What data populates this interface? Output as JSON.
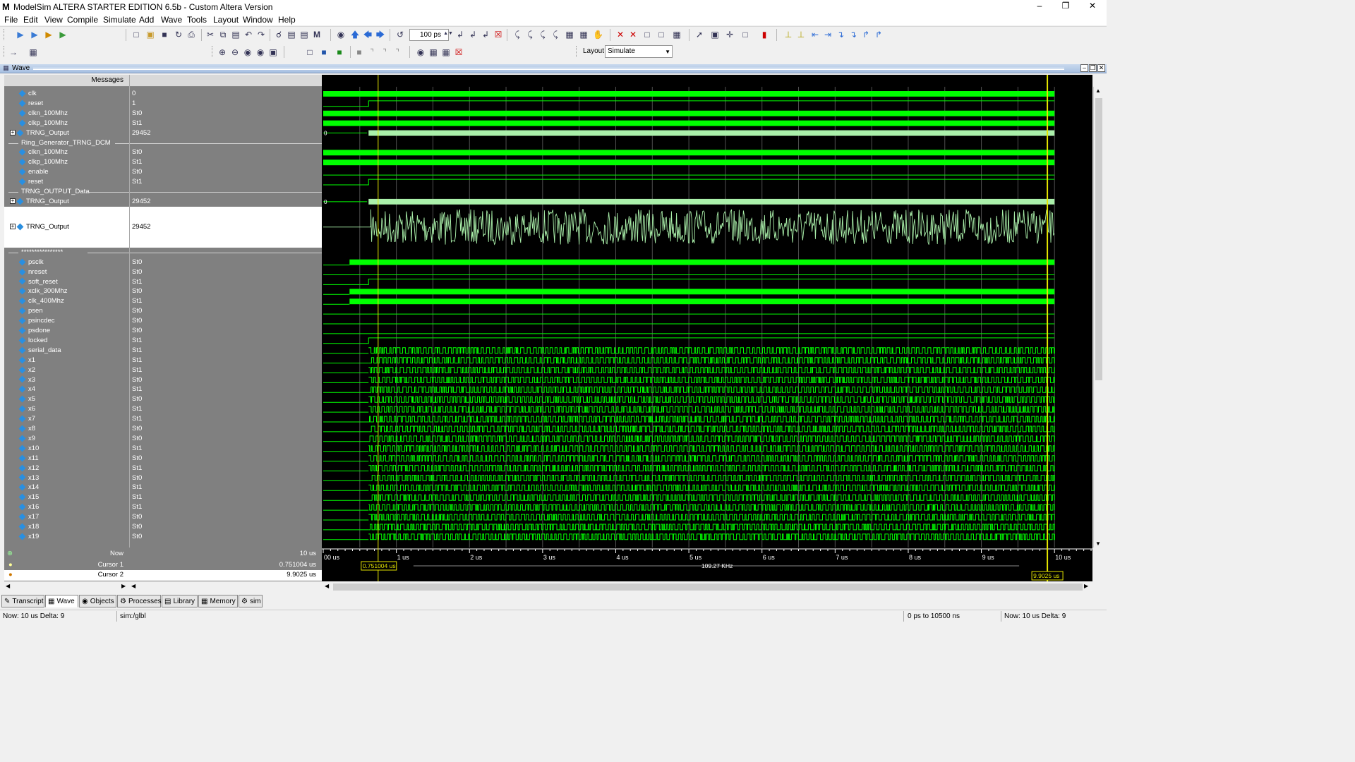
{
  "window": {
    "app_icon": "M",
    "title": "ModelSim ALTERA STARTER EDITION 6.5b - Custom Altera Version",
    "controls": [
      "minimize-icon",
      "restore-icon",
      "close-icon"
    ]
  },
  "menu": [
    "File",
    "Edit",
    "View",
    "Compile",
    "Simulate",
    "Add",
    "Wave",
    "Tools",
    "Layout",
    "Window",
    "Help"
  ],
  "toolbar": {
    "zoom_value": "100 ps",
    "layout_label": "Layout",
    "layout_value": "Simulate"
  },
  "wave_window": {
    "title": "Wave",
    "messages_header": "Messages"
  },
  "signals": [
    {
      "type": "signal",
      "name": "clk",
      "value": "0"
    },
    {
      "type": "signal",
      "name": "reset",
      "value": "1"
    },
    {
      "type": "signal",
      "name": "clkn_100Mhz",
      "value": "St0"
    },
    {
      "type": "signal",
      "name": "clkp_100Mhz",
      "value": "St1"
    },
    {
      "type": "bus",
      "name": "TRNG_Output",
      "value": "29452"
    },
    {
      "type": "divider",
      "name": "Ring_Generator_TRNG_DCM"
    },
    {
      "type": "signal",
      "name": "clkn_100Mhz",
      "value": "St0"
    },
    {
      "type": "signal",
      "name": "clkp_100Mhz",
      "value": "St1"
    },
    {
      "type": "signal",
      "name": "enable",
      "value": "St0"
    },
    {
      "type": "signal",
      "name": "reset",
      "value": "St1"
    },
    {
      "type": "divider",
      "name": "TRNG_OUTPUT_Data"
    },
    {
      "type": "bus",
      "name": "TRNG_Output",
      "value": "29452"
    },
    {
      "type": "analog",
      "name": "TRNG_Output",
      "value": "29452"
    },
    {
      "type": "divider",
      "name": "****************"
    },
    {
      "type": "signal",
      "name": "psclk",
      "value": "St0"
    },
    {
      "type": "signal",
      "name": "nreset",
      "value": "St0"
    },
    {
      "type": "signal",
      "name": "soft_reset",
      "value": "St1"
    },
    {
      "type": "signal",
      "name": "xclk_300Mhz",
      "value": "St0"
    },
    {
      "type": "signal",
      "name": "clk_400Mhz",
      "value": "St1"
    },
    {
      "type": "signal",
      "name": "psen",
      "value": "St0"
    },
    {
      "type": "signal",
      "name": "psincdec",
      "value": "St0"
    },
    {
      "type": "signal",
      "name": "psdone",
      "value": "St0"
    },
    {
      "type": "signal",
      "name": "locked",
      "value": "St1"
    },
    {
      "type": "signal",
      "name": "serial_data",
      "value": "St1"
    },
    {
      "type": "signal",
      "name": "x1",
      "value": "St1"
    },
    {
      "type": "signal",
      "name": "x2",
      "value": "St1"
    },
    {
      "type": "signal",
      "name": "x3",
      "value": "St0"
    },
    {
      "type": "signal",
      "name": "x4",
      "value": "St1"
    },
    {
      "type": "signal",
      "name": "x5",
      "value": "St0"
    },
    {
      "type": "signal",
      "name": "x6",
      "value": "St1"
    },
    {
      "type": "signal",
      "name": "x7",
      "value": "St1"
    },
    {
      "type": "signal",
      "name": "x8",
      "value": "St0"
    },
    {
      "type": "signal",
      "name": "x9",
      "value": "St0"
    },
    {
      "type": "signal",
      "name": "x10",
      "value": "St1"
    },
    {
      "type": "signal",
      "name": "x11",
      "value": "St0"
    },
    {
      "type": "signal",
      "name": "x12",
      "value": "St1"
    },
    {
      "type": "signal",
      "name": "x13",
      "value": "St0"
    },
    {
      "type": "signal",
      "name": "x14",
      "value": "St1"
    },
    {
      "type": "signal",
      "name": "x15",
      "value": "St1"
    },
    {
      "type": "signal",
      "name": "x16",
      "value": "St1"
    },
    {
      "type": "signal",
      "name": "x17",
      "value": "St0"
    },
    {
      "type": "signal",
      "name": "x18",
      "value": "St0"
    },
    {
      "type": "signal",
      "name": "x19",
      "value": "St0"
    }
  ],
  "bus_start_value": "0",
  "timeline": {
    "ticks": [
      "00 us",
      "1 us",
      "2 us",
      "3 us",
      "4 us",
      "5 us",
      "6 us",
      "7 us",
      "8 us",
      "9 us",
      "10 us"
    ],
    "start_us": 0,
    "end_us": 10.5,
    "cursor1_us": 0.751004,
    "cursor2_us": 9.9025
  },
  "cursors": {
    "now_label": "Now",
    "now_value": "10 us",
    "cursor1_label": "Cursor 1",
    "cursor1_value": "0.751004 us",
    "cursor2_label": "Cursor 2",
    "cursor2_value": "9.9025 us",
    "cursor1_tag": "0.751004 us",
    "cursor2_tag": "9.9025 us",
    "delta_freq": "109.27 KHz"
  },
  "tabs": [
    {
      "label": "Transcript",
      "icon": "transcript-icon",
      "active": false
    },
    {
      "label": "Wave",
      "icon": "wave-icon",
      "active": true
    },
    {
      "label": "Objects",
      "icon": "objects-icon",
      "active": false
    },
    {
      "label": "Processes",
      "icon": "processes-icon",
      "active": false
    },
    {
      "label": "Library",
      "icon": "library-icon",
      "active": false
    },
    {
      "label": "Memory",
      "icon": "memory-icon",
      "active": false
    },
    {
      "label": "sim",
      "icon": "sim-icon",
      "active": false
    }
  ],
  "status": {
    "left": "Now: 10 us  Delta: 9",
    "context": "sim:/glbl",
    "range": "0 ps to 10500 ns",
    "right": "Now: 10 us  Delta: 9"
  },
  "colors": {
    "wave": "#00ff00",
    "bus": "#aaf0aa",
    "cursor": "#e6e600",
    "grid": "#505050"
  }
}
